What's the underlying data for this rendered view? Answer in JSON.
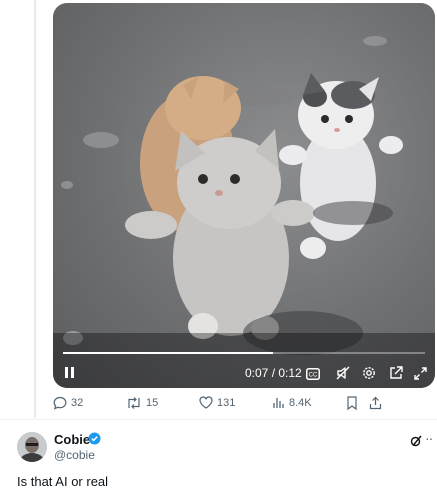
{
  "video": {
    "current_time": "0:07",
    "total_time": "0:12",
    "separator": " / ",
    "progress": 0.58,
    "muted": true,
    "icons": [
      "pause-icon",
      "captions-icon",
      "mute-icon",
      "settings-icon",
      "pop-out-icon",
      "fullscreen-icon"
    ]
  },
  "actions": {
    "replies": "32",
    "reposts": "15",
    "likes": "131",
    "views": "8.4K"
  },
  "reply": {
    "author_name": "Cobie",
    "author_handle": "@cobie",
    "text": "Is that AI or real"
  },
  "colors": {
    "verified": "#1d9bf0",
    "muted_text": "#536471",
    "text": "#0f1419"
  }
}
